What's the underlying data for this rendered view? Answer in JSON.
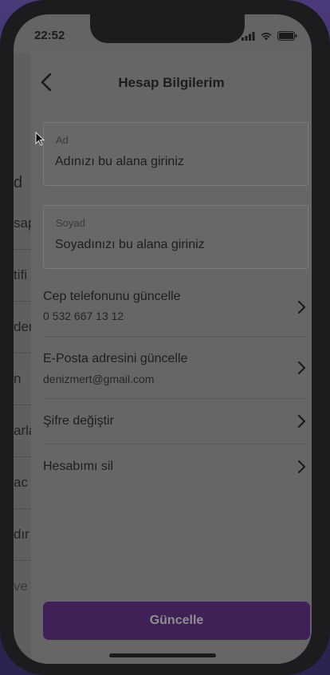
{
  "status_bar": {
    "time": "22:52"
  },
  "header": {
    "title": "Hesap Bilgilerim"
  },
  "form": {
    "first_name": {
      "label": "Ad",
      "placeholder": "Adınızı bu alana giriniz"
    },
    "last_name": {
      "label": "Soyad",
      "placeholder": "Soyadınızı bu alana giriniz"
    }
  },
  "settings": [
    {
      "title": "Cep telefonunu güncelle",
      "subtitle": "0 532 667 13 12"
    },
    {
      "title": "E-Posta adresini güncelle",
      "subtitle": "denizmert@gmail.com"
    },
    {
      "title": "Şifre değiştir"
    },
    {
      "title": "Hesabımı sil"
    }
  ],
  "underlying_sidebar": [
    "d",
    "sap",
    "tifi",
    "den",
    "n",
    "arla",
    "ac",
    "dır",
    "ve"
  ],
  "actions": {
    "update_label": "Güncelle"
  },
  "colors": {
    "primary_button": "#3f2157",
    "overlay_gray": "#666666"
  }
}
